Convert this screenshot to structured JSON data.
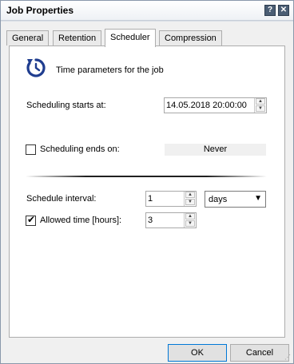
{
  "window": {
    "title": "Job Properties",
    "help_glyph": "?",
    "close_glyph": "✕"
  },
  "tabs": [
    {
      "label": "General"
    },
    {
      "label": "Retention"
    },
    {
      "label": "Scheduler",
      "active": true
    },
    {
      "label": "Compression"
    }
  ],
  "scheduler": {
    "icon": "clock-refresh-icon",
    "heading": "Time parameters for the job",
    "starts_label": "Scheduling starts at:",
    "starts_value": "14.05.2018 20:00:00",
    "ends_label": "Scheduling ends on:",
    "ends_checked": false,
    "ends_value": "Never",
    "interval_label": "Schedule interval:",
    "interval_value": "1",
    "interval_unit": "days",
    "allowed_label": "Allowed time [hours]:",
    "allowed_checked": true,
    "allowed_value": "3"
  },
  "buttons": {
    "ok": "OK",
    "cancel": "Cancel"
  },
  "colors": {
    "accent_icon": "#1f3d8f",
    "title_bar": "#eef1f5",
    "window_frame": "#d9dee6"
  }
}
